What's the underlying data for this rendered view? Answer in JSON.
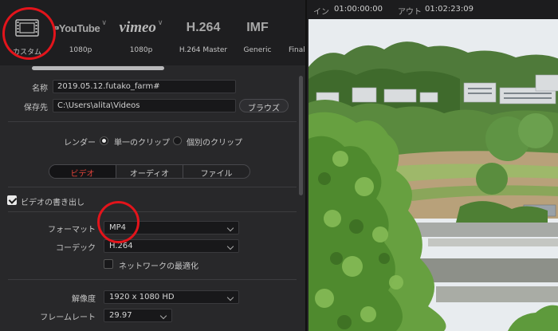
{
  "presets": [
    {
      "id": "custom",
      "logo_text": "",
      "label": "カスタム",
      "icon": "film-icon"
    },
    {
      "id": "youtube",
      "logo_text": "YouTube",
      "label": "1080p",
      "icon": "chevron-down-icon"
    },
    {
      "id": "vimeo",
      "logo_text": "vimeo",
      "label": "1080p",
      "icon": "chevron-down-icon"
    },
    {
      "id": "h264",
      "logo_text": "H.264",
      "label": "H.264 Master",
      "icon": ""
    },
    {
      "id": "imf",
      "logo_text": "IMF",
      "label": "Generic",
      "icon": ""
    },
    {
      "id": "final",
      "logo_text": "",
      "label": "Final",
      "icon": ""
    }
  ],
  "file": {
    "name_label": "名称",
    "name_value": "2019.05.12.futako_farm#",
    "location_label": "保存先",
    "location_value": "C:\\Users\\alita\\Videos",
    "browse_label": "ブラウズ"
  },
  "render": {
    "label": "レンダー",
    "single_clip": "単一のクリップ",
    "individual_clips": "個別のクリップ",
    "selected": "single_clip"
  },
  "tabs": [
    {
      "label": "ビデオ",
      "active": true
    },
    {
      "label": "オーディオ",
      "active": false
    },
    {
      "label": "ファイル",
      "active": false
    }
  ],
  "video": {
    "export_label": "ビデオの書き出し",
    "export_checked": true,
    "format_label": "フォーマット",
    "format_value": "MP4",
    "codec_label": "コーデック",
    "codec_value": "H.264",
    "network_opt_label": "ネットワークの最適化",
    "network_opt_checked": false,
    "resolution_label": "解像度",
    "resolution_value": "1920 x 1080 HD",
    "framerate_label": "フレームレート",
    "framerate_value": "29.97"
  },
  "viewer": {
    "in_label": "イン",
    "in_timecode": "01:00:00:00",
    "out_label": "アウト",
    "out_timecode": "01:02:23:09"
  },
  "colors": {
    "highlight_circle": "#e3141b",
    "active_tab_text": "#e2433a"
  }
}
